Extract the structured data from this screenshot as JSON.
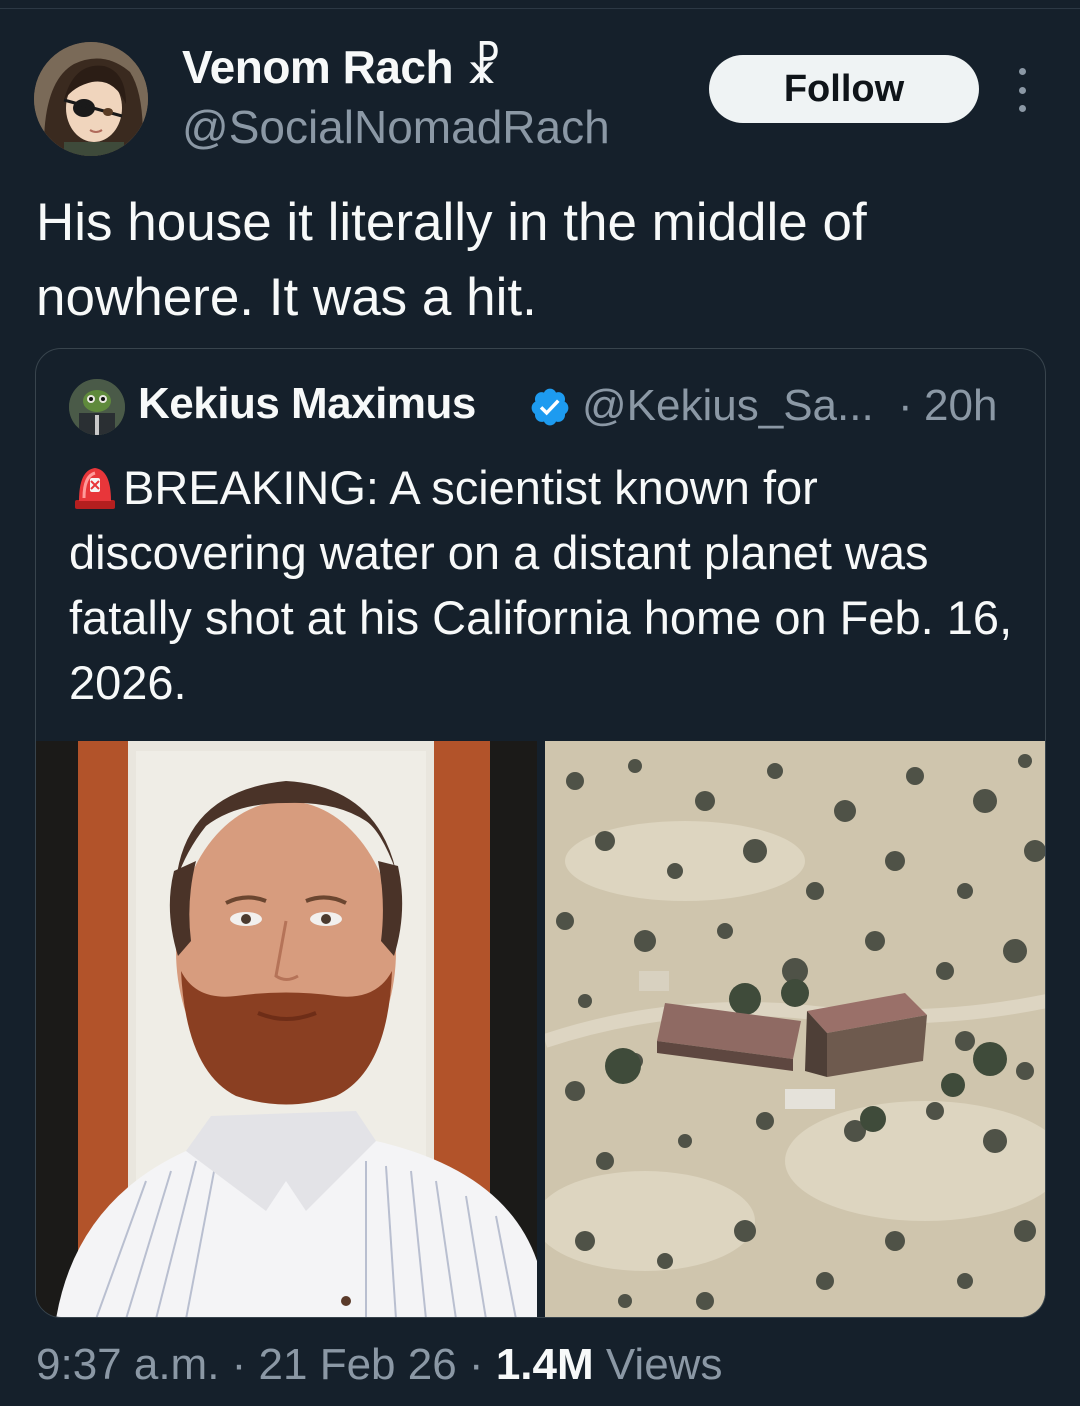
{
  "author": {
    "name": "Venom Rach ☧",
    "handle": "@SocialNomadRach",
    "follow_label": "Follow"
  },
  "tweet": {
    "text": "His house it literally in the middle of nowhere. It was a hit."
  },
  "quote": {
    "name": "Kekius Maximus",
    "handle": "@Kekius_Sa...",
    "separator": "·",
    "time": "20h",
    "text": "BREAKING: A scientist known for discovering water on a distant planet was fatally shot at his California home on Feb. 16, 2026.",
    "icons": [
      "siren-icon",
      "verified-icon"
    ],
    "media": [
      {
        "name": "portrait-photo",
        "description_shown": false
      },
      {
        "name": "aerial-house-photo",
        "description_shown": false
      }
    ]
  },
  "footer": {
    "time": "9:37 a.m.",
    "sep1": " · ",
    "date": "21 Feb 26",
    "sep2": " · ",
    "views_count": "1.4M",
    "views_label": " Views"
  },
  "colors": {
    "background": "#15202b",
    "verified": "#1d9bf0",
    "secondary_text": "#8b98a5"
  }
}
